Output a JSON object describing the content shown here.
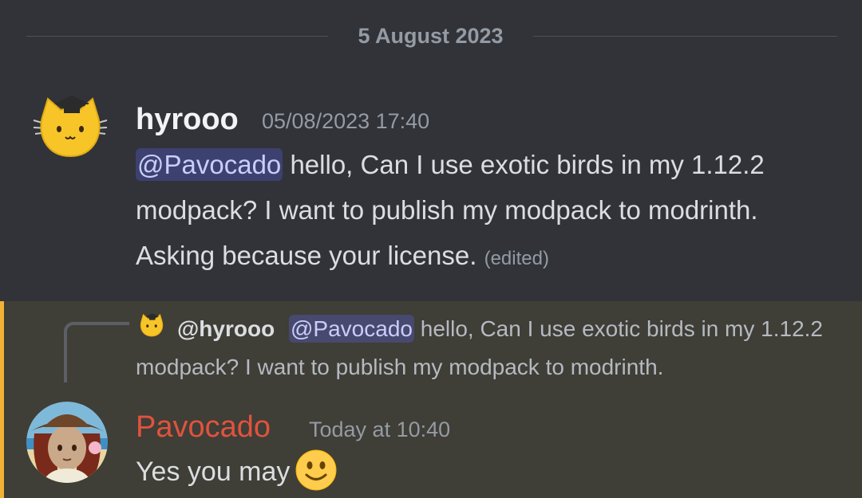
{
  "divider": {
    "date": "5 August 2023"
  },
  "message1": {
    "author": "hyrooo",
    "timestamp": "05/08/2023 17:40",
    "mention": "@Pavocado",
    "text": " hello, Can I use exotic birds in my 1.12.2 modpack? I want to publish my modpack to modrinth. Asking because your license.",
    "edited": "(edited)",
    "avatar_icon": "cat-graduation-cap-icon"
  },
  "message2": {
    "reply": {
      "author": "@hyrooo",
      "mention": "@Pavocado",
      "text": " hello, Can I use exotic birds in my 1.12.2 modpack? I want to publish my modpack to modrinth.",
      "avatar_icon": "cat-graduation-cap-icon"
    },
    "author": "Pavocado",
    "author_color": "#e0533d",
    "timestamp": "Today at 10:40",
    "text": "Yes you may",
    "emoji": "slightly-smiling-face-icon",
    "highlight_color": "#f0b232"
  }
}
